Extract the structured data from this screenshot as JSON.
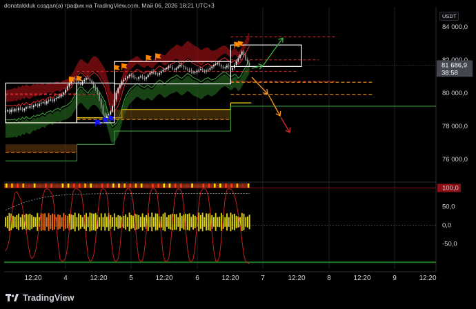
{
  "header": {
    "attribution": "donatakkluk создал(а) график на TradingView.com, Май 06, 2026 18:21 UTC+3",
    "currency": "USDT"
  },
  "price_axis": {
    "ticks": [
      "84 000,0",
      "82 000,0",
      "80 000,0",
      "78 000,0",
      "76 000,0"
    ],
    "last_price_label": "81 686,9",
    "countdown_label": "38:58"
  },
  "oscillator_axis": {
    "ticks": [
      "100,0",
      "50,0",
      "0,0",
      "-50,0"
    ]
  },
  "time_axis": {
    "ticks": [
      "12:20",
      "4",
      "12:20",
      "5",
      "12:20",
      "6",
      "12:20",
      "7",
      "12:20",
      "8",
      "12:20",
      "9",
      "12:20"
    ]
  },
  "branding": {
    "logo_icon": "tradingview-logo-icon",
    "name": "TradingView"
  },
  "colors": {
    "background": "#000000",
    "bull_candle": "#e8e8e8",
    "upper_band": "#8b0f14",
    "lower_band": "#1f5a1c",
    "red_line": "#e0282e",
    "green_line": "#2f8a2f",
    "yellow_line": "#f2d31f",
    "orange_dash": "#ff9a1f",
    "white_box": "#ffffff",
    "arrow_green": "#3cb043",
    "arrow_orange": "#ff9a1f",
    "arrow_red": "#e0282e",
    "signal_orange": "#ff8a00",
    "signal_blue": "#1515ff",
    "osc_red": "#c41e1e",
    "osc_yellow": "#f2e41f"
  },
  "chart_data": {
    "type": "line",
    "ylim": [
      74700,
      85200
    ],
    "oscillator_ylim": [
      -118,
      112
    ],
    "close": [
      78900,
      78950,
      78850,
      79000,
      78900,
      79050,
      78950,
      79100,
      79000,
      78950,
      79050,
      79150,
      79100,
      79200,
      79150,
      79250,
      79300,
      79200,
      79350,
      79400,
      79450,
      79350,
      79500,
      79550,
      79600,
      79500,
      79650,
      79700,
      79750,
      79800,
      79900,
      80000,
      80200,
      80400,
      80600,
      80800,
      80900,
      80850,
      80700,
      80600,
      80500,
      80700,
      80800,
      80900,
      80850,
      80750,
      80600,
      80400,
      80200,
      80000,
      79600,
      79200,
      78700,
      78500,
      78600,
      78700,
      78900,
      79200,
      79600,
      80000,
      80300,
      80500,
      80700,
      80800,
      80900,
      81000,
      81100,
      81050,
      80950,
      80900,
      80850,
      80950,
      81000,
      80900,
      80850,
      80950,
      81100,
      81200,
      81300,
      81250,
      81150,
      81100,
      81200,
      81300,
      81400,
      81450,
      81500,
      81600,
      81550,
      81450,
      81400,
      81500,
      81600,
      81700,
      81650,
      81550,
      81450,
      81400,
      81350,
      81300,
      81200,
      81250,
      81350,
      81400,
      81450,
      81350,
      81300,
      81350,
      81400,
      81500,
      81600,
      81700,
      81750,
      81800,
      81700,
      81600,
      81500,
      81550,
      81650,
      81600,
      81400,
      81500,
      81700,
      81900,
      82100,
      82300,
      82500,
      82300,
      82000,
      81800,
      81686.9
    ],
    "oscillator": [
      -70,
      -60,
      -40,
      10,
      60,
      85,
      90,
      80,
      70,
      50,
      20,
      -10,
      -50,
      -80,
      -90,
      -85,
      -70,
      -40,
      0,
      40,
      80,
      95,
      98,
      96,
      90,
      80,
      50,
      0,
      -50,
      -90,
      -98,
      -96,
      -90,
      -60,
      -10,
      50,
      90,
      97,
      98,
      95,
      90,
      70,
      20,
      -40,
      -85,
      -97,
      -95,
      -80,
      -40,
      20,
      70,
      95,
      98,
      95,
      85,
      40,
      -20,
      -70,
      -95,
      -98,
      -90,
      -60,
      0,
      60,
      92,
      98,
      97,
      90,
      60,
      10,
      -50,
      -90,
      -99,
      -95,
      -70,
      -20,
      40,
      85,
      97,
      98,
      95,
      80,
      30,
      -30,
      -80,
      -97,
      -98,
      -90,
      -50,
      10,
      65,
      93,
      98,
      96,
      88,
      50,
      -10,
      -65,
      -95,
      -99,
      -92,
      -60,
      0,
      55,
      90,
      97,
      98,
      95,
      80,
      40,
      -20,
      -70,
      -96,
      -98,
      -85,
      -40,
      20,
      70,
      95,
      98,
      97,
      92,
      80,
      60,
      30,
      0,
      -40,
      -80,
      -98,
      -100,
      -105
    ]
  }
}
